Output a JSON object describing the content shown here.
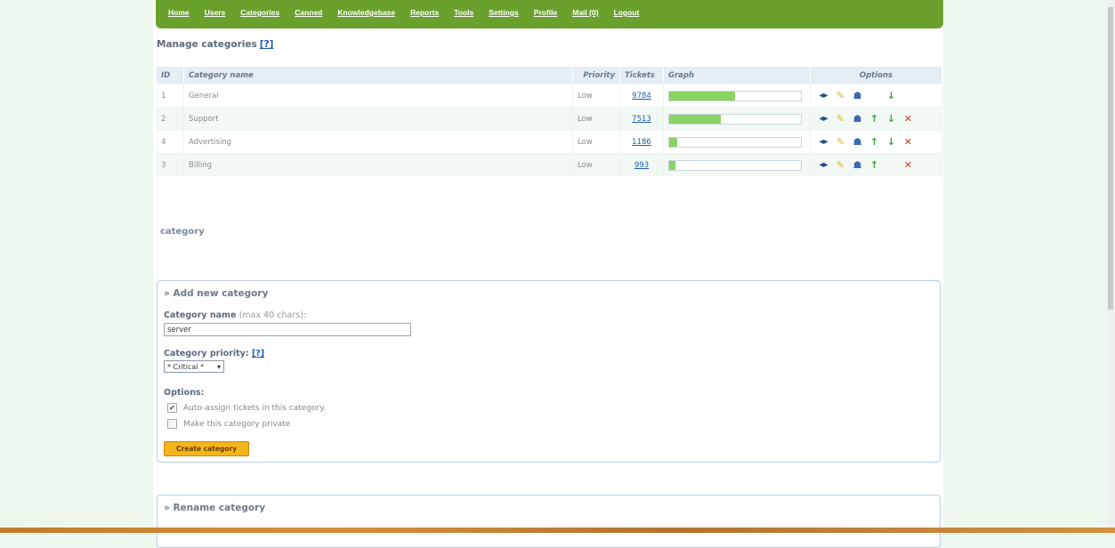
{
  "nav": {
    "items": [
      "Home",
      "Users",
      "Categories",
      "Canned",
      "Knowledgebase",
      "Reports",
      "Tools",
      "Settings",
      "Profile",
      "Mail (0)",
      "Logout"
    ]
  },
  "manage": {
    "title": "Manage categories",
    "help": "[?]"
  },
  "table": {
    "headers": {
      "id": "ID",
      "name": "Category name",
      "priority": "Priority",
      "tickets": "Tickets",
      "graph": "Graph",
      "options": "Options"
    },
    "rows": [
      {
        "id": "1",
        "name": "General",
        "priority": "Low",
        "tickets": "9784",
        "graph_percent": 50,
        "actions": [
          "arrows-icon",
          "bulb-icon",
          "user-icon",
          "",
          "down-arrow-icon",
          ""
        ]
      },
      {
        "id": "2",
        "name": "Support",
        "priority": "Low",
        "tickets": "7513",
        "graph_percent": 39,
        "actions": [
          "arrows-icon",
          "bulb-icon",
          "user-icon",
          "up-arrow-icon",
          "down-arrow-icon",
          "delete-icon"
        ]
      },
      {
        "id": "4",
        "name": "Advertising",
        "priority": "Low",
        "tickets": "1186",
        "graph_percent": 6,
        "actions": [
          "arrows-icon",
          "bulb-icon",
          "user-icon",
          "up-arrow-icon",
          "down-arrow-icon",
          "delete-icon"
        ]
      },
      {
        "id": "3",
        "name": "Billing",
        "priority": "Low",
        "tickets": "993",
        "graph_percent": 5,
        "actions": [
          "arrows-icon",
          "bulb-icon",
          "user-icon",
          "up-arrow-icon",
          "",
          "delete-icon"
        ]
      }
    ]
  },
  "category_label": "category",
  "add": {
    "title": "» Add new category",
    "name_label": "Category name",
    "name_hint": "(max 40 chars):",
    "name_value": "server",
    "priority_label": "Category priority:",
    "priority_help": "[?]",
    "priority_value": "* Critical *",
    "options_label": "Options:",
    "opt_auto": "Auto-assign tickets in this category.",
    "opt_private": "Make this category private",
    "opt_auto_checked": true,
    "opt_private_checked": false,
    "button": "Create category"
  },
  "rename": {
    "title": "» Rename category"
  },
  "colors": {
    "nav": "#6aa12c",
    "bar": "#8ad464",
    "button": "#f2b51c"
  }
}
